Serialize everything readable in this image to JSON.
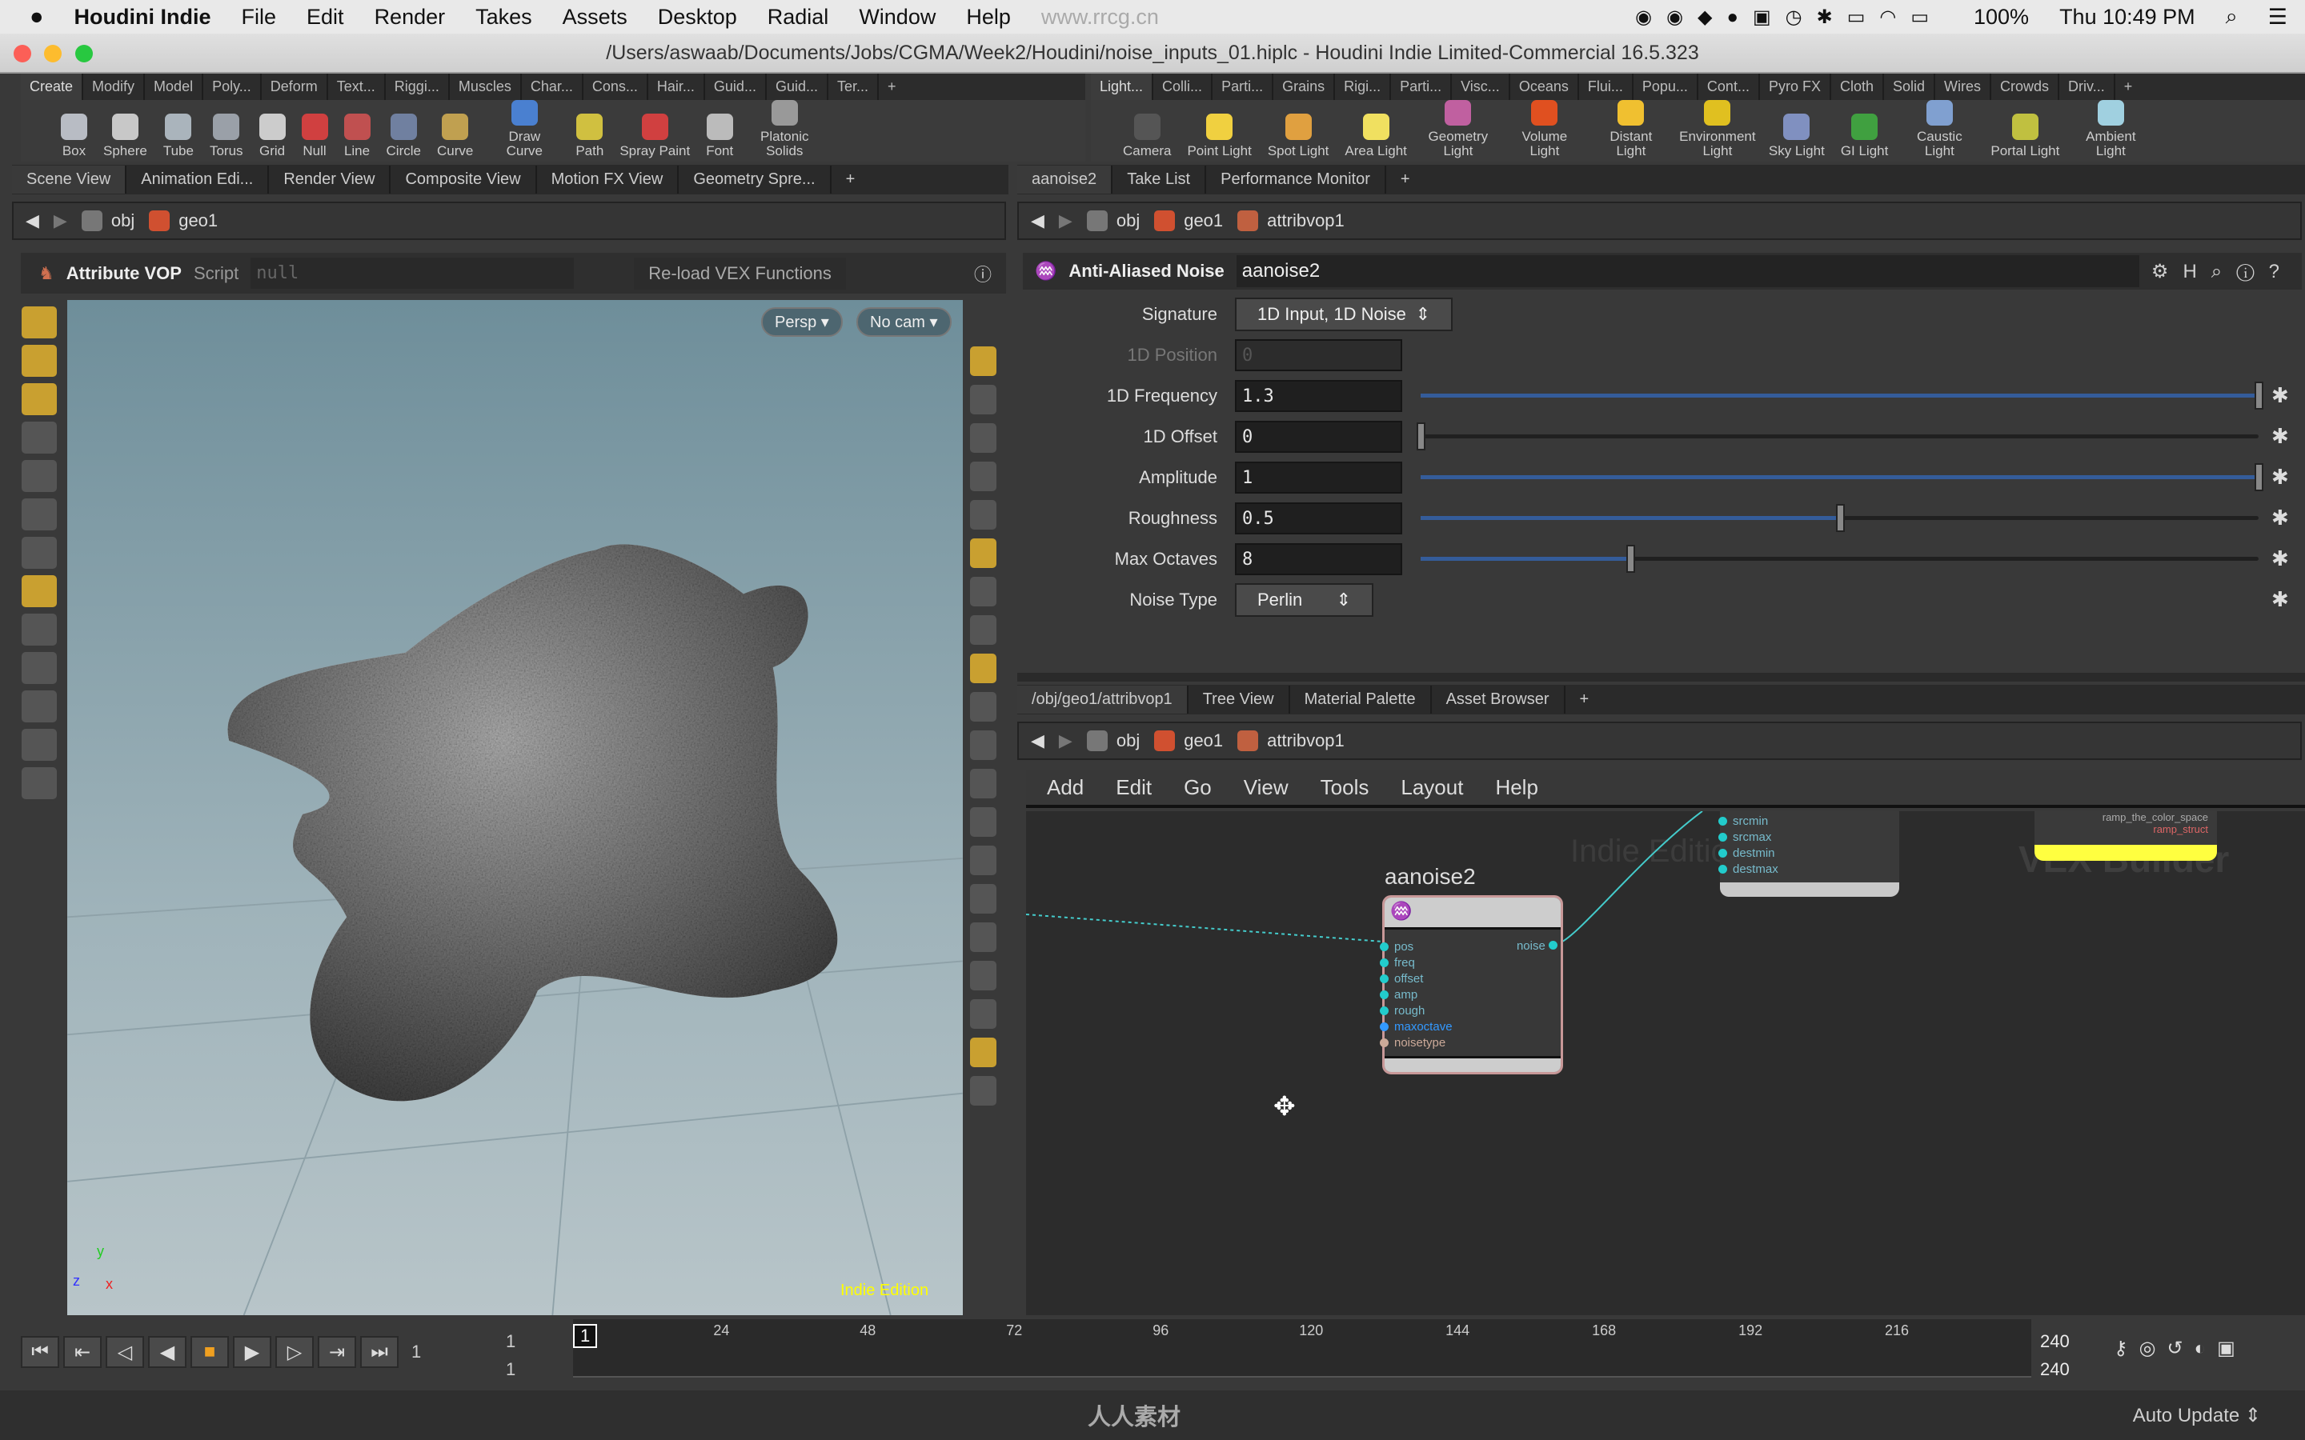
{
  "menubar": {
    "app": "Houdini Indie",
    "items": [
      "File",
      "Edit",
      "Render",
      "Takes",
      "Assets",
      "Desktop",
      "Radial",
      "Window",
      "Help"
    ],
    "watermark": "www.rrcg.cn",
    "battery": "100%",
    "clock": "Thu 10:49 PM"
  },
  "window": {
    "title": "/Users/aswaab/Documents/Jobs/CGMA/Week2/Houdini/noise_inputs_01.hiplc - Houdini Indie Limited-Commercial 16.5.323"
  },
  "shelf_left": {
    "tabs": [
      "Create",
      "Modify",
      "Model",
      "Poly...",
      "Deform",
      "Text...",
      "Riggi...",
      "Muscles",
      "Char...",
      "Cons...",
      "Hair...",
      "Guid...",
      "Guid...",
      "Ter..."
    ],
    "tools": [
      {
        "label": "Box",
        "color": "#b8bcc4"
      },
      {
        "label": "Sphere",
        "color": "#c8c8c8"
      },
      {
        "label": "Tube",
        "color": "#aab4bc"
      },
      {
        "label": "Torus",
        "color": "#9aa0a8"
      },
      {
        "label": "Grid",
        "color": "#cccccc"
      },
      {
        "label": "Null",
        "color": "#d04040"
      },
      {
        "label": "Line",
        "color": "#c05050"
      },
      {
        "label": "Circle",
        "color": "#7080a0"
      },
      {
        "label": "Curve",
        "color": "#c0a050"
      },
      {
        "label": "Draw Curve",
        "color": "#4a80d0"
      },
      {
        "label": "Path",
        "color": "#d0c040"
      },
      {
        "label": "Spray Paint",
        "color": "#d04040"
      },
      {
        "label": "Font",
        "color": "#bbbbbb"
      },
      {
        "label": "Platonic Solids",
        "color": "#999999"
      }
    ]
  },
  "shelf_right": {
    "tabs": [
      "Light...",
      "Colli...",
      "Parti...",
      "Grains",
      "Rigi...",
      "Parti...",
      "Visc...",
      "Oceans",
      "Flui...",
      "Popu...",
      "Cont...",
      "Pyro FX",
      "Cloth",
      "Solid",
      "Wires",
      "Crowds",
      "Driv..."
    ],
    "tools": [
      {
        "label": "Camera",
        "color": "#555555"
      },
      {
        "label": "Point Light",
        "color": "#f0d040"
      },
      {
        "label": "Spot Light",
        "color": "#e0a040"
      },
      {
        "label": "Area Light",
        "color": "#f0e060"
      },
      {
        "label": "Geometry Light",
        "color": "#c060a0"
      },
      {
        "label": "Volume Light",
        "color": "#e05020"
      },
      {
        "label": "Distant Light",
        "color": "#f0c030"
      },
      {
        "label": "Environment Light",
        "color": "#e0c020"
      },
      {
        "label": "Sky Light",
        "color": "#8090c0"
      },
      {
        "label": "GI Light",
        "color": "#40a040"
      },
      {
        "label": "Caustic Light",
        "color": "#80a0d0"
      },
      {
        "label": "Portal Light",
        "color": "#c0c040"
      },
      {
        "label": "Ambient Light",
        "color": "#a0d0e0"
      }
    ]
  },
  "left_pane": {
    "tabs": [
      "Scene View",
      "Animation Edi...",
      "Render View",
      "Composite View",
      "Motion FX View",
      "Geometry Spre..."
    ],
    "path": [
      "obj",
      "geo1"
    ],
    "operator": {
      "type": "Attribute VOP",
      "script_label": "Script",
      "script_value": "null",
      "reload": "Re-load VEX Functions"
    },
    "viewport": {
      "persp": "Persp",
      "cam": "No cam",
      "edition": "Indie Edition",
      "axes": [
        "y",
        "z",
        "x"
      ]
    }
  },
  "params": {
    "tabs": [
      "aanoise2",
      "Take List",
      "Performance Monitor"
    ],
    "path": [
      "obj",
      "geo1",
      "attribvop1"
    ],
    "node_type": "Anti-Aliased Noise",
    "node_name": "aanoise2",
    "signature": {
      "label": "Signature",
      "value": "1D Input, 1D Noise"
    },
    "position": {
      "label": "1D Position",
      "value": "0"
    },
    "rows": [
      {
        "label": "1D Frequency",
        "value": "1.3",
        "fraction": 1.0
      },
      {
        "label": "1D Offset",
        "value": "0",
        "fraction": 0.0
      },
      {
        "label": "Amplitude",
        "value": "1",
        "fraction": 1.0
      },
      {
        "label": "Roughness",
        "value": "0.5",
        "fraction": 0.5
      },
      {
        "label": "Max Octaves",
        "value": "8",
        "fraction": 0.25
      }
    ],
    "noise_type": {
      "label": "Noise Type",
      "value": "Perlin"
    }
  },
  "network": {
    "tabs": [
      "/obj/geo1/attribvop1",
      "Tree View",
      "Material Palette",
      "Asset Browser"
    ],
    "path": [
      "obj",
      "geo1",
      "attribvop1"
    ],
    "menu": [
      "Add",
      "Edit",
      "Go",
      "View",
      "Tools",
      "Layout",
      "Help"
    ],
    "watermarks": [
      "Indie Edition",
      "VEX Builder"
    ],
    "node": {
      "name": "aanoise2",
      "inputs": [
        "pos",
        "freq",
        "offset",
        "amp",
        "rough",
        "maxoctave",
        "noisetype"
      ],
      "output": "noise"
    },
    "fit_node": {
      "inputs": [
        "srcmin",
        "srcmax",
        "destmin",
        "destmax"
      ]
    },
    "ramp_node": {
      "outputs": [
        "ramp_the_color_space",
        "ramp_struct"
      ]
    }
  },
  "timeline": {
    "current": "1",
    "start": "1",
    "start2": "1",
    "end": "240",
    "end2": "240",
    "ticks": [
      "24",
      "48",
      "72",
      "96",
      "120",
      "144",
      "168",
      "192",
      "216"
    ],
    "frame_field": "1"
  },
  "status": {
    "logo": "人人素材",
    "update": "Auto Update"
  }
}
